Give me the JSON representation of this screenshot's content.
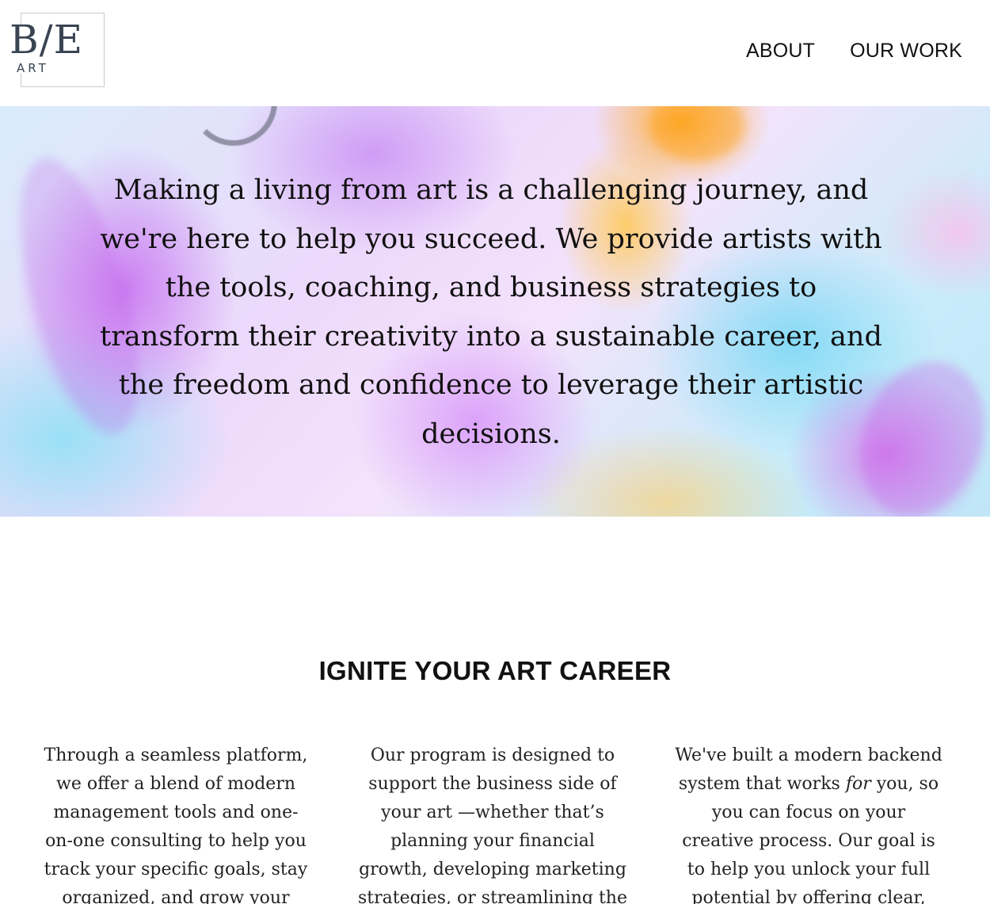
{
  "header": {
    "logo_mark": "B/E",
    "logo_sub": "ART",
    "nav": [
      {
        "label": "ABOUT"
      },
      {
        "label": "OUR WORK"
      }
    ]
  },
  "hero": {
    "text": "Making a living from art is a challenging journey, and we're here to help you succeed. We provide artists with the tools, coaching, and business strategies to transform their creativity into a sustainable career, and the freedom and confidence to leverage their artistic decisions."
  },
  "section": {
    "title": "IGNITE YOUR ART CAREER",
    "columns": [
      {
        "text": "Through a seamless platform, we offer a blend of modern management tools and one-on-one consulting to help you track your specific goals, stay organized, and grow your"
      },
      {
        "text": "Our program is designed to support the business side of your art —whether that’s planning your financial growth, developing marketing strategies, or streamlining the"
      },
      {
        "text_before": "We've built a modern backend system that works ",
        "text_em": "for",
        "text_after": " you, so you can focus on your creative process. Our goal is to help you unlock your full potential by offering clear, strategic"
      }
    ]
  },
  "colors": {
    "text": "#111111",
    "logo": "#3a4452",
    "background": "#ffffff"
  }
}
